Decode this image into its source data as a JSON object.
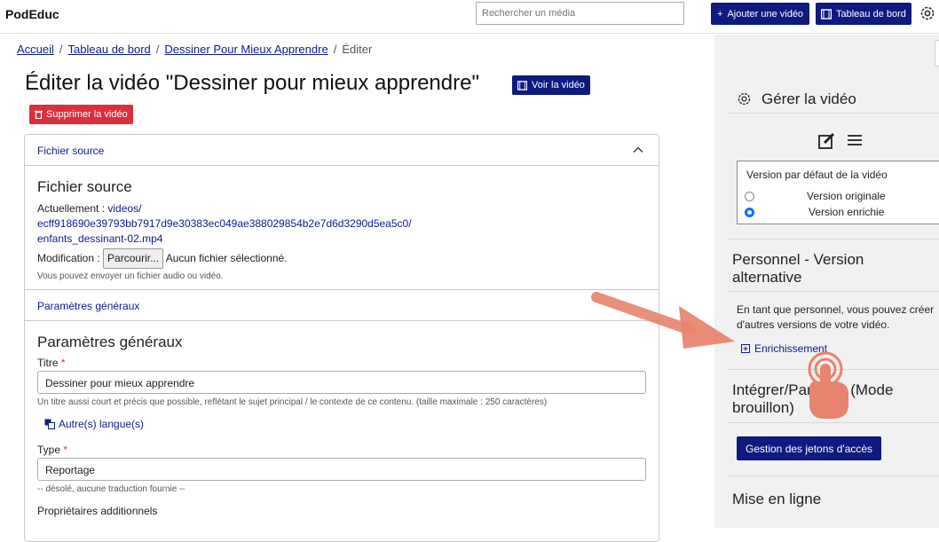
{
  "app": {
    "brand": "PodEduc"
  },
  "header": {
    "search_placeholder": "Rechercher un média",
    "add_video_label": "Ajouter une vidéo",
    "dashboard_label": "Tableau de bord"
  },
  "breadcrumb": {
    "items": [
      "Accueil",
      "Tableau de bord",
      "Dessiner Pour Mieux Apprendre"
    ],
    "current": "Éditer",
    "separator": "/"
  },
  "page": {
    "title": "Éditer la vidéo \"Dessiner pour mieux apprendre\"",
    "view_label": "Voir la vidéo",
    "delete_label": "Supprimer la vidéo"
  },
  "source": {
    "header": "Fichier source",
    "heading": "Fichier source",
    "current_prefix": "Actuellement : ",
    "current_link_lines": [
      "videos/",
      "ecff918690e39793bb7917d9e30383ec049ae388029854b2e7d6d3290d5ea5c0/",
      "enfants_dessinant-02.mp4"
    ],
    "modify_label": "Modification :",
    "browse_label": "Parcourir...",
    "no_file": "Aucun fichier sélectionné.",
    "hint": "Vous pouvez envoyer un fichier audio ou vidéo."
  },
  "general": {
    "header": "Paramètres généraux",
    "heading": "Paramètres généraux",
    "title_label": "Titre",
    "title_value": "Dessiner pour mieux apprendre",
    "title_help": "Un titre aussi court et précis que possible, reflétant le sujet principal / le contexte de ce contenu. (taille maximale : 250 caractères)",
    "other_lang": "Autre(s) langue(s)",
    "type_label": "Type",
    "type_value": "Reportage",
    "type_help": "-- désolé, aucune traduction fournie --",
    "owners_label": "Propriétaires additionnels",
    "required_mark": "*"
  },
  "sidebar": {
    "manage_title": "Gérer la vidéo",
    "version_title": "Version par défaut de la vidéo",
    "versions": [
      {
        "label": "Version originale",
        "selected": false
      },
      {
        "label": "Version enrichie",
        "selected": true
      }
    ],
    "staff_title": "Personnel - Version alternative",
    "staff_text": "En tant que personnel, vous pouvez créer d'autres versions de votre vidéo.",
    "enrich_link": "Enrichissement",
    "share_title": "Intégrer/Partager (Mode brouillon)",
    "tokens_label": "Gestion des jetons d'accès",
    "online_title": "Mise en ligne"
  },
  "colors": {
    "navy": "#0e1a7e",
    "danger": "#d9303e",
    "arrow": "#e8836d"
  }
}
